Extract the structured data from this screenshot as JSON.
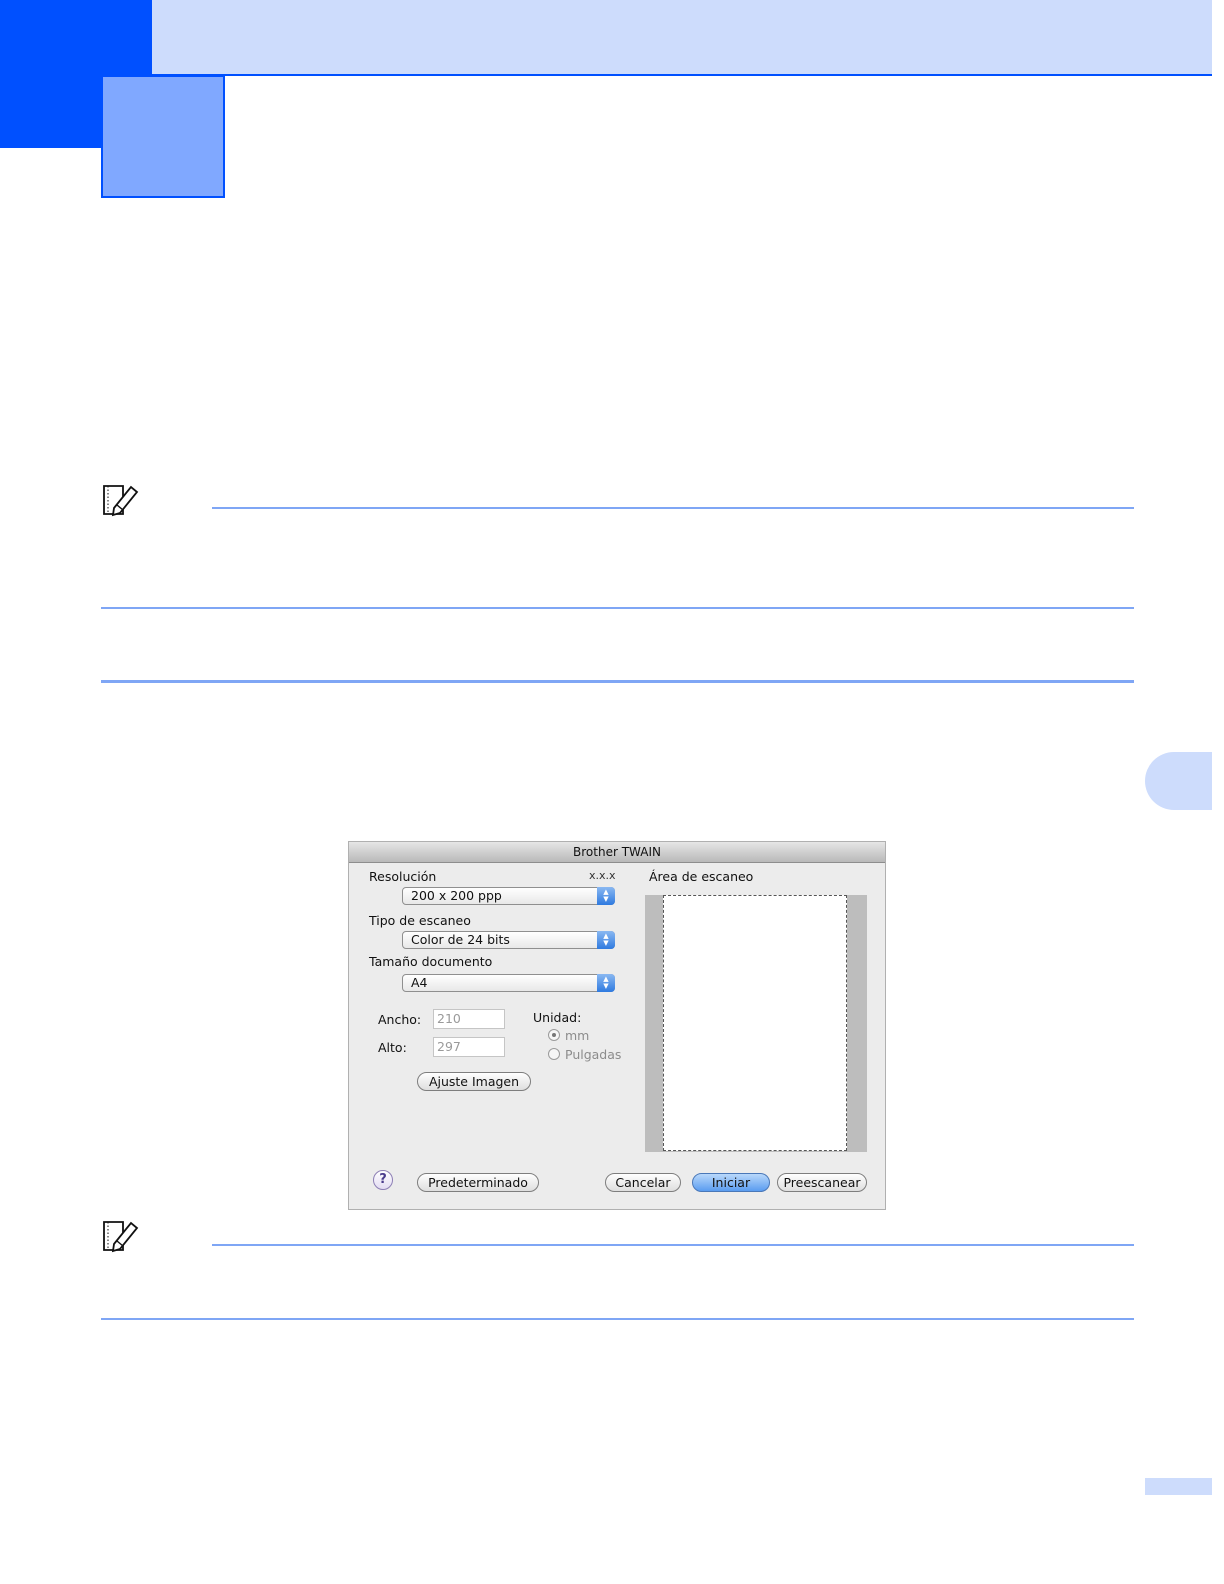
{
  "dialog": {
    "title": "Brother TWAIN",
    "version": "x.x.x",
    "resolution": {
      "label": "Resolución",
      "value": "200 x 200 ppp"
    },
    "scan_type": {
      "label": "Tipo de escaneo",
      "value": "Color de 24 bits"
    },
    "document_size": {
      "label": "Tamaño documento",
      "value": "A4"
    },
    "width": {
      "label": "Ancho:",
      "value": "210"
    },
    "height": {
      "label": "Alto:",
      "value": "297"
    },
    "unit": {
      "label": "Unidad:",
      "options": [
        "mm",
        "Pulgadas"
      ],
      "selected": "mm"
    },
    "adjust_button": "Ajuste Imagen",
    "scan_area_label": "Área de escaneo",
    "buttons": {
      "default": "Predeterminado",
      "cancel": "Cancelar",
      "start": "Iniciar",
      "prescan": "Preescanear"
    },
    "help_icon": "?"
  },
  "colors": {
    "brand_blue": "#0050ff",
    "light_blue": "#cddcfc",
    "rule_blue": "#7fa6f5"
  },
  "icons": {
    "note": "note-pencil-icon",
    "help": "help-icon"
  }
}
